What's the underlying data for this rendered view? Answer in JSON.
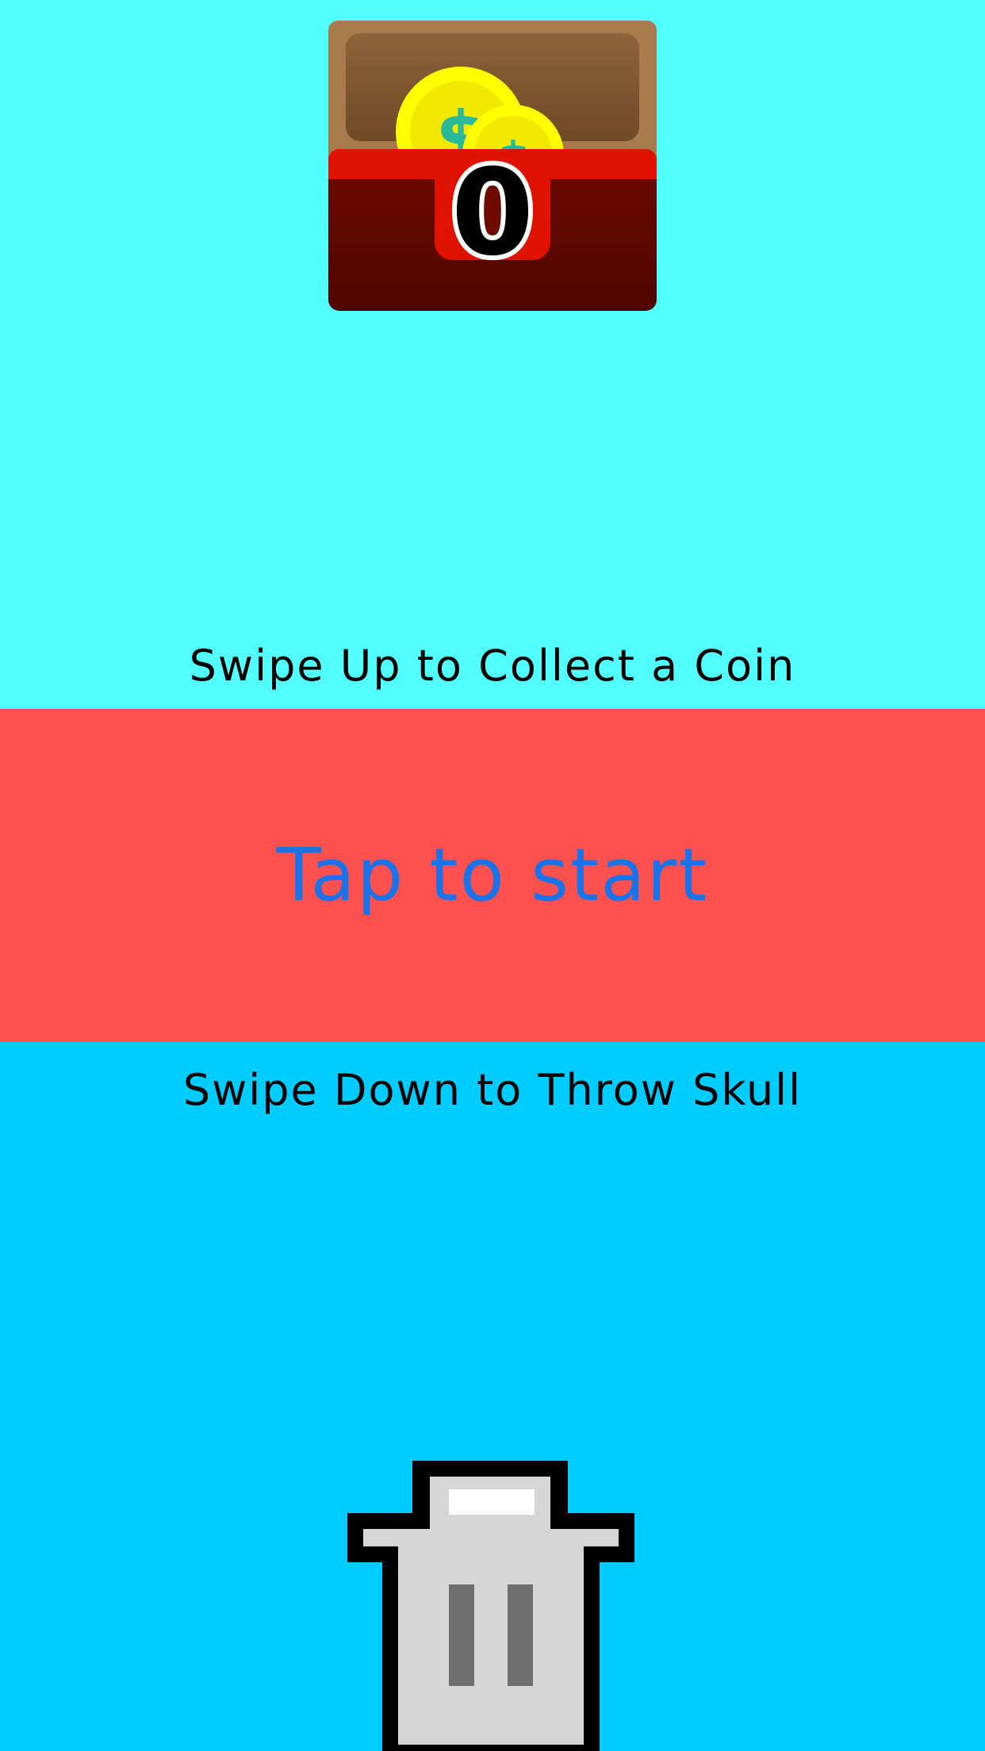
{
  "score": {
    "coins": "0"
  },
  "hints": {
    "swipe_up": "Swipe Up to Collect a Coin",
    "swipe_down": "Swipe Down to Throw Skull"
  },
  "start": {
    "label": "Tap to start"
  },
  "icons": {
    "chest": "treasure-chest-icon",
    "coin": "dollar-coin-icon",
    "trash": "trash-can-icon"
  },
  "colors": {
    "top_zone": "#52ffff",
    "middle_zone": "#ff5050",
    "bottom_zone": "#00ccff",
    "start_text": "#1a73e8",
    "hint_text": "#000000"
  }
}
